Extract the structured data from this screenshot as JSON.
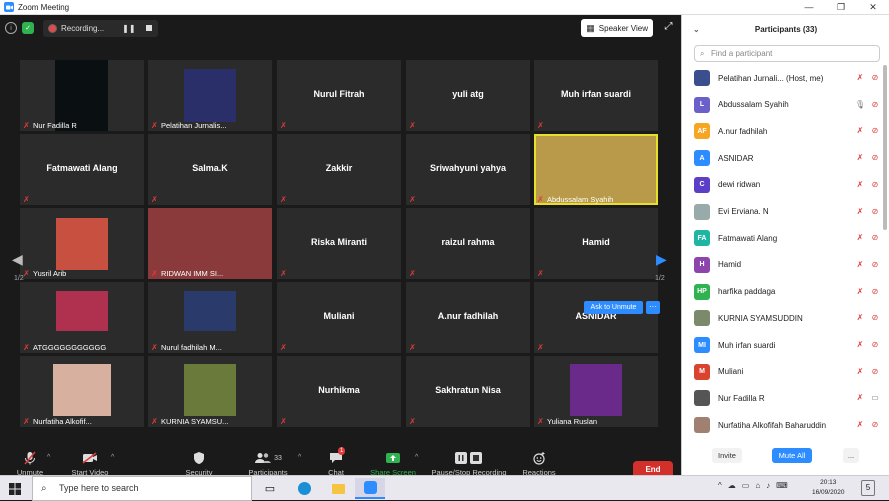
{
  "window": {
    "title": "Zoom Meeting",
    "controls": [
      "—",
      "❐",
      "✕"
    ]
  },
  "topbar": {
    "recording_label": "Recording...",
    "speaker_view_label": "Speaker View"
  },
  "tiles": [
    {
      "label": "Nur Fadilla R"
    },
    {
      "label": "Pelatihan Jurnalis..."
    },
    {
      "name": "Nurul Fitrah"
    },
    {
      "name": "yuli atg"
    },
    {
      "name": "Muh irfan suardi"
    },
    {
      "name": "Fatmawati Alang"
    },
    {
      "name": "Salma.K"
    },
    {
      "name": "Zakkir"
    },
    {
      "name": "Sriwahyuni yahya"
    },
    {
      "label": "Abdussalam Syahih"
    },
    {
      "label": "Yusril Arib"
    },
    {
      "label": "RIDWAN IMM SI..."
    },
    {
      "name": "Riska Miranti"
    },
    {
      "name": "raizul rahma"
    },
    {
      "name": "Hamid"
    },
    {
      "label": "ATGGGGGGGGGGG"
    },
    {
      "label": "Nurul fadhilah M..."
    },
    {
      "name": "Muliani"
    },
    {
      "name": "A.nur fadhilah"
    },
    {
      "name": "ASNIDAR"
    },
    {
      "label": "Nurfatiha Alkofif..."
    },
    {
      "label": "KURNIA SYAMSU..."
    },
    {
      "name": "Nurhikma"
    },
    {
      "name": "Sakhratun Nisa"
    },
    {
      "label": "Yuliana Ruslan"
    }
  ],
  "pagination": {
    "left": "1/2",
    "right": "1/2"
  },
  "ask_to_unmute": "Ask to Unmute",
  "more_label": "···",
  "toolbar": {
    "unmute": "Unmute",
    "start_video": "Start Video",
    "security": "Security",
    "participants": "Participants",
    "participants_count": "33",
    "chat": "Chat",
    "chat_badge": "1",
    "share_screen": "Share Screen",
    "pause_stop": "Pause/Stop Recording",
    "reactions": "Reactions",
    "end": "End"
  },
  "panel": {
    "title": "Participants (33)",
    "search_placeholder": "Find a participant",
    "participants": [
      {
        "name": "Pelatihan Jurnali... (Host, me)",
        "initials": "",
        "color": "#3b4f8f"
      },
      {
        "name": "Abdussalam Syahih",
        "initials": "L",
        "color": "#6b5fc9"
      },
      {
        "name": "A.nur fadhilah",
        "initials": "AF",
        "color": "#f5a623"
      },
      {
        "name": "ASNIDAR",
        "initials": "A",
        "color": "#2d8cff"
      },
      {
        "name": "dewi ridwan",
        "initials": "C",
        "color": "#5b3fc7"
      },
      {
        "name": "Evi Erviana. N",
        "initials": "",
        "color": "#9aa"
      },
      {
        "name": "Fatmawati Alang",
        "initials": "FA",
        "color": "#1fb5a4"
      },
      {
        "name": "Hamid",
        "initials": "H",
        "color": "#8e44ad"
      },
      {
        "name": "harfika paddaga",
        "initials": "HP",
        "color": "#2fb24f"
      },
      {
        "name": "KURNIA SYAMSUDDIN",
        "initials": "",
        "color": "#7a8a6a"
      },
      {
        "name": "Muh irfan suardi",
        "initials": "MI",
        "color": "#2d8cff"
      },
      {
        "name": "Muliani",
        "initials": "M",
        "color": "#d9432f"
      },
      {
        "name": "Nur Fadilla R",
        "initials": "",
        "color": "#555"
      },
      {
        "name": "Nurfatiha Alkofifah Baharuddin",
        "initials": "",
        "color": "#a08070"
      }
    ],
    "invite": "Invite",
    "mute_all": "Mute All",
    "more": "..."
  },
  "taskbar": {
    "search_placeholder": "Type here to search",
    "time": "20:13",
    "date": "16/09/2020",
    "notifications": "5"
  }
}
